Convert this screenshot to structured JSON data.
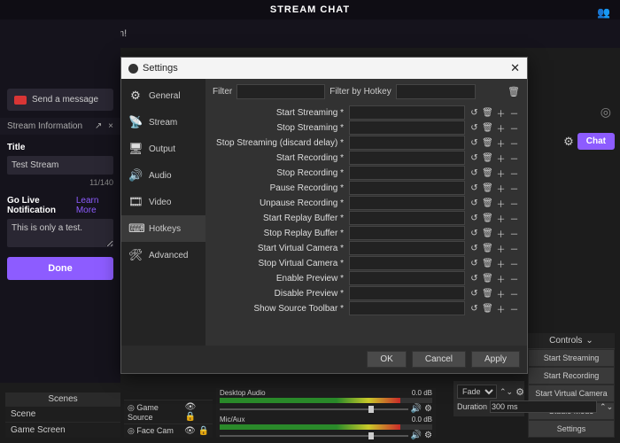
{
  "topbar": {
    "title": "STREAM CHAT"
  },
  "welcome": "Welcome to the chat room!",
  "chat": {
    "placeholder": "Send a message"
  },
  "stream_info": {
    "header": "Stream Information",
    "title_label": "Title",
    "title_value": "Test Stream",
    "char_count": "11/140",
    "go_live_label": "Go Live Notification",
    "learn_more": "Learn More",
    "notif_value": "This is only a test.",
    "done": "Done"
  },
  "right": {
    "chat_btn": "Chat"
  },
  "controls": {
    "header": "Controls",
    "buttons": [
      "Start Streaming",
      "Start Recording",
      "Start Virtual Camera",
      "Studio Mode",
      "Settings"
    ]
  },
  "transition": {
    "fade": "Fade",
    "duration_label": "Duration",
    "duration_value": "300 ms"
  },
  "mixer": {
    "tracks": [
      {
        "name": "Desktop Audio",
        "db": "0.0 dB"
      },
      {
        "name": "Mic/Aux",
        "db": "0.0 dB"
      }
    ]
  },
  "scenes": {
    "header": "Scenes",
    "items": [
      "Scene",
      "Game Screen"
    ]
  },
  "sources": {
    "items": [
      "Game Source",
      "Face Cam"
    ]
  },
  "settings": {
    "title": "Settings",
    "side": [
      {
        "icon": "⚙",
        "label": "General"
      },
      {
        "icon": "📡",
        "label": "Stream"
      },
      {
        "icon": "🖥",
        "label": "Output"
      },
      {
        "icon": "🔊",
        "label": "Audio"
      },
      {
        "icon": "🎞",
        "label": "Video"
      },
      {
        "icon": "⌨",
        "label": "Hotkeys"
      },
      {
        "icon": "🛠",
        "label": "Advanced"
      }
    ],
    "active_side": 5,
    "filter_label": "Filter",
    "filter_hotkey_label": "Filter by Hotkey",
    "hotkeys": [
      "Start Streaming *",
      "Stop Streaming *",
      "Stop Streaming (discard delay) *",
      "Start Recording *",
      "Stop Recording *",
      "Pause Recording *",
      "Unpause Recording *",
      "Start Replay Buffer *",
      "Stop Replay Buffer *",
      "Start Virtual Camera *",
      "Stop Virtual Camera *",
      "Enable Preview *",
      "Disable Preview *",
      "Show Source Toolbar *"
    ],
    "footer": {
      "ok": "OK",
      "cancel": "Cancel",
      "apply": "Apply"
    }
  }
}
